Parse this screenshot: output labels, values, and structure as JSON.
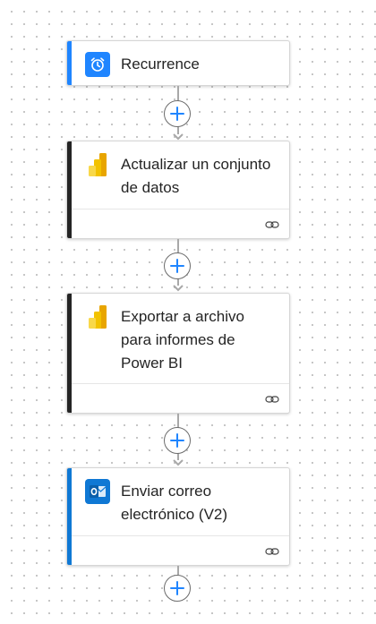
{
  "flow": {
    "steps": [
      {
        "title": "Recurrence",
        "icon": "alarm-clock-icon",
        "accent": "#1f85ff",
        "icon_bg": "#1f85ff"
      },
      {
        "title": "Actualizar un conjunto de datos",
        "icon": "power-bi-icon",
        "accent": "#242424",
        "icon_bg": "transparent",
        "footer_icon": "link-icon"
      },
      {
        "title": "Exportar a archivo para informes de Power BI",
        "icon": "power-bi-icon",
        "accent": "#242424",
        "icon_bg": "transparent",
        "footer_icon": "link-icon"
      },
      {
        "title": "Enviar correo electrónico (V2)",
        "icon": "outlook-icon",
        "accent": "#0f78d4",
        "icon_bg": "#0f78d4",
        "footer_icon": "link-icon"
      }
    ],
    "add_step_icon": "plus-icon",
    "add_button_color": "#1f85ff"
  }
}
